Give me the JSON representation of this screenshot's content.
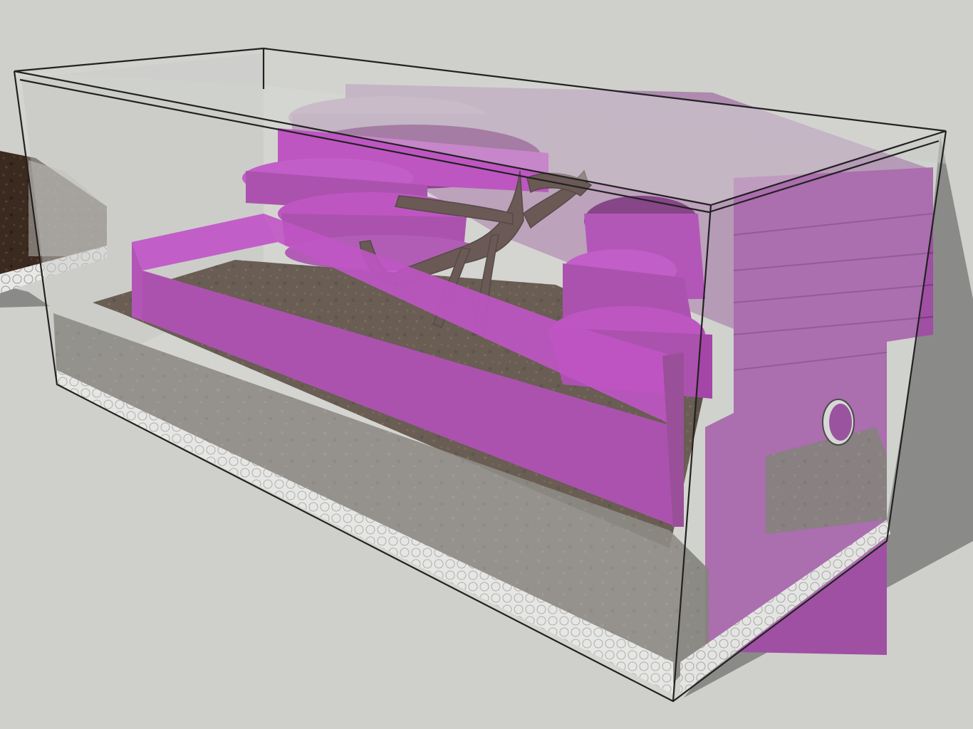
{
  "scene": {
    "subject": "terrarium-3d-model",
    "colors": {
      "background": "#cfd0cb",
      "shadow": "#8a8b88",
      "glass_edge": "#222222",
      "magenta_front": "#961b9c",
      "magenta_top": "#b52bbf",
      "magenta_dark": "#640a66",
      "magenta_side": "#b021b8",
      "magenta_panel": "#9f50a3",
      "magenta_ghost": "#a77ea9",
      "soil": "#3b2a1f",
      "soil_light": "#5a4330",
      "substrate": "#6e6a64",
      "substrate_light": "#8a8580",
      "drainage": "#e6e6e4",
      "root": "#3c2420",
      "root_light": "#5a3a33"
    },
    "icons": {
      "vent": "circle-vent-icon"
    }
  }
}
